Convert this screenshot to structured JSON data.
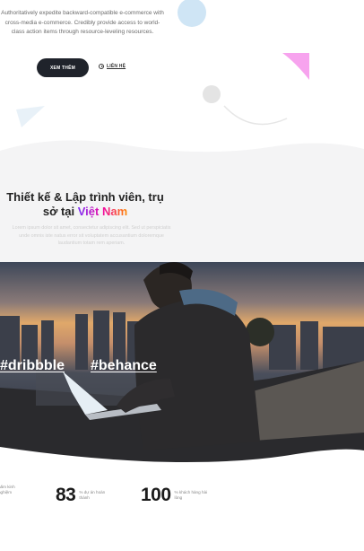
{
  "hero": {
    "description": "Authoritatively expedite backward-compatible e-commerce with cross-media e-commerce. Credibly provide access to world-class action items through resource-leveling resources.",
    "more_button": "XEM THÊM",
    "contact_link": "LIÊN HỆ"
  },
  "about": {
    "title_main": "Thiết kế & Lập trình viên, trụ sở tại ",
    "title_accent": "Việt Nam",
    "description": "Lorem ipsum dolor sit amet, consectetur adipiscing elit. Sed ut perspiciatis unde omnis iste natus error sit voluptatem accusantium doloremque laudantium totam rem aperiam."
  },
  "social": {
    "hashtags": [
      "#dribbble",
      "#behance"
    ]
  },
  "stats": [
    {
      "number": "",
      "label": "năm kinh nghiệm"
    },
    {
      "number": "83",
      "label": "% dự án hoàn thành"
    },
    {
      "number": "100",
      "label": "% khách hàng hài lòng"
    }
  ],
  "colors": {
    "accent_gradient": [
      "#7b2ff7",
      "#f107a3",
      "#ff8a00"
    ],
    "dark_button": "#1f232b",
    "deco_pink": "#f7a3ee",
    "deco_blue": "#cfe5f5"
  }
}
